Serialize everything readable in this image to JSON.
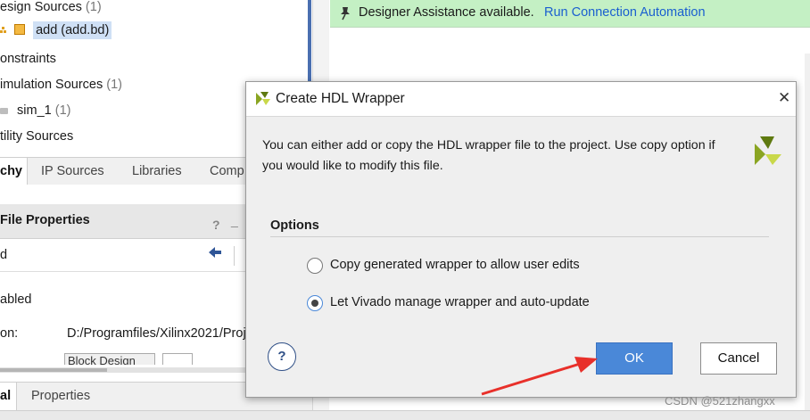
{
  "left_panel": {
    "tree": [
      {
        "label": "esign Sources",
        "count": "(1)"
      },
      {
        "label": "add (add.bd)",
        "count": ""
      },
      {
        "label": "onstraints",
        "count": ""
      },
      {
        "label": "imulation Sources",
        "count": "(1)"
      },
      {
        "label": "sim_1",
        "count": "(1)"
      },
      {
        "label": "tility Sources",
        "count": ""
      }
    ],
    "tabs": [
      "chy",
      "IP Sources",
      "Libraries",
      "Comp"
    ],
    "file_properties": {
      "title": "File Properties",
      "help": "?",
      "minimize": "_",
      "name_value": "d",
      "enabled_label": "abled",
      "location_label": "on:",
      "location_value": "D:/Programfiles/Xilinx2021/Proj",
      "type_value": "Block Design"
    },
    "bottom_tabs": [
      "al",
      "Properties"
    ]
  },
  "banner": {
    "text": "Designer Assistance available.",
    "link": "Run Connection Automation"
  },
  "dialog": {
    "title": "Create HDL Wrapper",
    "description_line1": "You can either add or copy the HDL wrapper file to the project. Use copy option if",
    "description_line2": "you would like to modify this file.",
    "options_heading": "Options",
    "options": [
      {
        "label": "Copy generated wrapper to allow user edits",
        "selected": false
      },
      {
        "label": "Let Vivado manage wrapper and auto-update",
        "selected": true
      }
    ],
    "help_label": "?",
    "ok_label": "OK",
    "cancel_label": "Cancel",
    "close_label": "✕"
  },
  "watermark": "CSDN @521zhangxx",
  "colors": {
    "ok_button": "#4a88d8",
    "banner": "#c4f0c4",
    "link": "#1a5fd0",
    "annotation_arrow": "#e8302a",
    "selection": "#cfe0f5"
  }
}
